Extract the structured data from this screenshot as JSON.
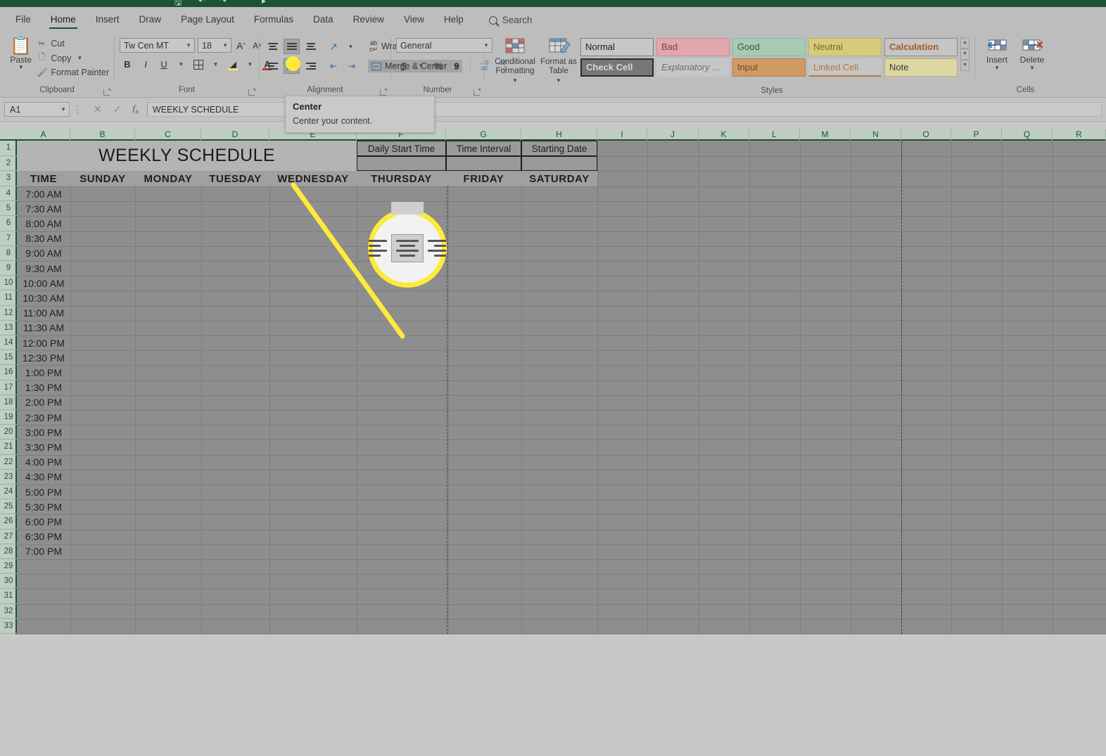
{
  "app": {
    "tabs": [
      {
        "label": "File",
        "active": false
      },
      {
        "label": "Home",
        "active": true
      },
      {
        "label": "Insert",
        "active": false
      },
      {
        "label": "Draw",
        "active": false
      },
      {
        "label": "Page Layout",
        "active": false
      },
      {
        "label": "Formulas",
        "active": false
      },
      {
        "label": "Data",
        "active": false
      },
      {
        "label": "Review",
        "active": false
      },
      {
        "label": "View",
        "active": false
      },
      {
        "label": "Help",
        "active": false
      }
    ],
    "search_label": "Search",
    "accent_color": "#1b5336",
    "highlight_color": "#ffe93b"
  },
  "ribbon": {
    "clipboard": {
      "group_label": "Clipboard",
      "paste_label": "Paste",
      "items": [
        {
          "label": "Cut",
          "icon": "scissors-icon"
        },
        {
          "label": "Copy",
          "icon": "copy-icon"
        },
        {
          "label": "Format Painter",
          "icon": "paintbrush-icon"
        }
      ]
    },
    "font": {
      "group_label": "Font",
      "font_name": "Tw Cen MT",
      "font_size": "18",
      "grow_font": "A",
      "shrink_font": "A",
      "bold": "B",
      "italic": "I",
      "underline": "U",
      "borders_icon": "borders-icon",
      "fill_color_icon": "fill-color-icon",
      "font_color_icon": "font-color-icon"
    },
    "alignment": {
      "group_label": "Alignment",
      "wrap_text_label": "Wrap Text",
      "merge_center_label": "Merge & Center",
      "top_align": "align-top",
      "middle_align": "align-middle",
      "bottom_align": "align-bottom",
      "align_left": "align-left",
      "align_center": "align-center",
      "align_right": "align-right",
      "decrease_indent": "decrease-indent",
      "increase_indent": "increase-indent",
      "orientation": "orientation-icon",
      "selected_button": "align-center"
    },
    "number": {
      "group_label": "Number",
      "format": "General",
      "currency": "$",
      "percent": "%",
      "comma": "9",
      "decrease_decimal": ".00",
      "increase_decimal": ".00"
    },
    "styles": {
      "group_label": "Styles",
      "conditional_formatting": "Conditional Formatting",
      "format_as_table": "Format as Table",
      "cell_styles": [
        {
          "label": "Normal",
          "bg": "#c6c6c6",
          "fg": "#1f1f1f",
          "border": "#7d7d7d",
          "italic": false,
          "bold": false
        },
        {
          "label": "Bad",
          "bg": "#e0a8ad",
          "fg": "#8a3a3f",
          "border": "#c79196",
          "italic": false,
          "bold": false
        },
        {
          "label": "Good",
          "bg": "#a8c9b3",
          "fg": "#2e5c42",
          "border": "#93b49e",
          "italic": false,
          "bold": false
        },
        {
          "label": "Neutral",
          "bg": "#d6cb7a",
          "fg": "#7a6a1e",
          "border": "#bdb268",
          "italic": false,
          "bold": false
        },
        {
          "label": "Calculation",
          "bg": "#c5c5c5",
          "fg": "#a85a23",
          "border": "#8c8c8c",
          "italic": false,
          "bold": true
        },
        {
          "label": "Check Cell",
          "bg": "#777777",
          "fg": "#d8d8d8",
          "border": "#2b2b2b",
          "italic": false,
          "bold": true
        },
        {
          "label": "Explanatory ...",
          "bg": "#c6c6c6",
          "fg": "#6e6e6e",
          "border": "#c6c6c6",
          "italic": true,
          "bold": false
        },
        {
          "label": "Input",
          "bg": "#d09a64",
          "fg": "#6a4a1d",
          "border": "#b07f4c",
          "italic": false,
          "bold": false
        },
        {
          "label": "Linked Cell",
          "bg": "#c5c5c5",
          "fg": "#b5793a",
          "border": "#c5c5c5",
          "italic": false,
          "bold": false
        },
        {
          "label": "Note",
          "bg": "#ddd6a1",
          "fg": "#3a3a3a",
          "border": "#b9b07f",
          "italic": false,
          "bold": false
        }
      ]
    },
    "cells": {
      "group_label": "Cells",
      "items": [
        {
          "label": "Insert",
          "icon": "insert-cells-icon"
        },
        {
          "label": "Delete",
          "icon": "delete-cells-icon"
        }
      ]
    }
  },
  "formula_bar": {
    "name_box": "A1",
    "cancel_icon": "cancel-icon",
    "confirm_icon": "confirm-icon",
    "function_icon": "fx-icon",
    "value": "WEEKLY SCHEDULE"
  },
  "tooltip": {
    "title": "Center",
    "body": "Center your content."
  },
  "sheet": {
    "column_headers": [
      "A",
      "B",
      "C",
      "D",
      "E",
      "F",
      "G",
      "H",
      "I",
      "J",
      "K",
      "L",
      "M",
      "N",
      "O",
      "P",
      "Q",
      "R"
    ],
    "row_headers": [
      "1",
      "2",
      "3",
      "4",
      "5",
      "6",
      "7",
      "8",
      "9",
      "10",
      "11",
      "12",
      "13",
      "14",
      "15",
      "16",
      "17",
      "18",
      "19",
      "20",
      "21",
      "22",
      "23",
      "24",
      "25",
      "26",
      "27",
      "28",
      "29",
      "30",
      "31",
      "32",
      "33"
    ],
    "title_cell": "WEEKLY SCHEDULE",
    "param_headers": [
      "Daily Start Time",
      "Time Interval",
      "Starting Date"
    ],
    "param_values": [
      "",
      "",
      ""
    ],
    "day_headers": [
      "TIME",
      "SUNDAY",
      "MONDAY",
      "TUESDAY",
      "WEDNESDAY",
      "THURSDAY",
      "FRIDAY",
      "SATURDAY"
    ],
    "times": [
      "7:00 AM",
      "7:30 AM",
      "8:00 AM",
      "8:30 AM",
      "9:00 AM",
      "9:30 AM",
      "10:00 AM",
      "10:30 AM",
      "11:00 AM",
      "11:30 AM",
      "12:00 PM",
      "12:30 PM",
      "1:00 PM",
      "1:30 PM",
      "2:00 PM",
      "2:30 PM",
      "3:00 PM",
      "3:30 PM",
      "4:00 PM",
      "4:30 PM",
      "5:00 PM",
      "5:30 PM",
      "6:00 PM",
      "6:30 PM",
      "7:00 PM"
    ]
  }
}
